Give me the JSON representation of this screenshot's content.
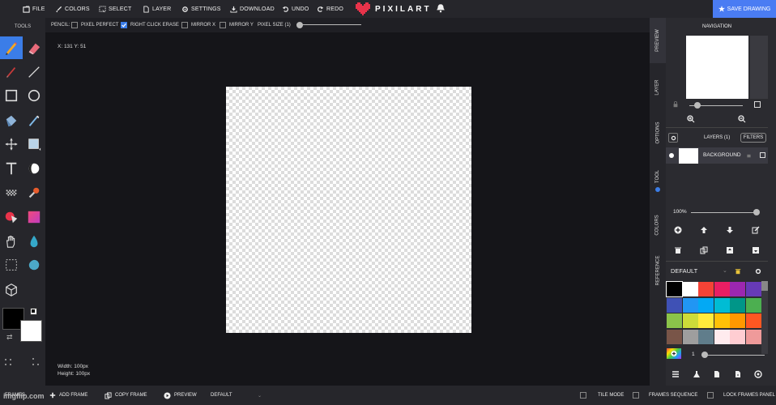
{
  "menu": {
    "file": "FILE",
    "colors": "COLORS",
    "select": "SELECT",
    "layer": "LAYER",
    "settings": "SETTINGS",
    "download": "DOWNLOAD",
    "undo": "UNDO",
    "redo": "REDO"
  },
  "logo_text": "PIXILART",
  "save_label": "SAVE DRAWING",
  "tools_label": "TOOLS",
  "options": {
    "mode_label": "PENCIL:",
    "pixel_perfect": {
      "label": "PIXEL PERFECT",
      "checked": false
    },
    "right_click_erase": {
      "label": "RIGHT CLICK ERASE",
      "checked": true
    },
    "mirror_x": {
      "label": "MIRROR X",
      "checked": false
    },
    "mirror_y": {
      "label": "MIRROR Y",
      "checked": false
    },
    "pixel_size_label": "PIXEL SIZE (1)"
  },
  "canvas": {
    "coords": "X: 131 Y: 51",
    "width_text": "Width: 100px",
    "height_text": "Height: 100px"
  },
  "side_tabs": [
    "PREVIEW",
    "LAYER",
    "OPTIONS",
    "TOOL",
    "COLORS",
    "REFERENCE"
  ],
  "navigation": {
    "title": "NAVIGATION"
  },
  "layers": {
    "title": "LAYERS (1)",
    "filters_label": "FILTERS",
    "items": [
      {
        "name": "BACKGROUND"
      }
    ],
    "opacity": "100%"
  },
  "palette": {
    "name": "DEFAULT",
    "colors": [
      "#000000",
      "#ffffff",
      "#f44336",
      "#e91e63",
      "#9c27b0",
      "#673ab7",
      "#3f51b5",
      "#2196f3",
      "#03a9f4",
      "#00bcd4",
      "#009688",
      "#4caf50",
      "#8bc34a",
      "#cddc39",
      "#ffeb3b",
      "#ffc107",
      "#ff9800",
      "#ff5722",
      "#795548",
      "#9e9e9e",
      "#607d8b",
      "#ffebee",
      "#ffcdd2",
      "#ef9a9a"
    ],
    "brush_size": "1"
  },
  "colors": {
    "primary": "#000000",
    "secondary": "#ffffff",
    "accent": "#3b7de8",
    "logo_heart": "#e8334a"
  },
  "bottom": {
    "frames_label": "FRAMES",
    "add_frame": "ADD FRAME",
    "copy_frame": "COPY FRAME",
    "preview": "PREVIEW",
    "frame_name": "DEFAULT",
    "tile_mode": "TILE MODE",
    "frames_sequence": "FRAMES SEQUENCE",
    "lock_frames_panel": "LOCK FRAMES PANEL"
  },
  "watermark": "imgflip.com"
}
